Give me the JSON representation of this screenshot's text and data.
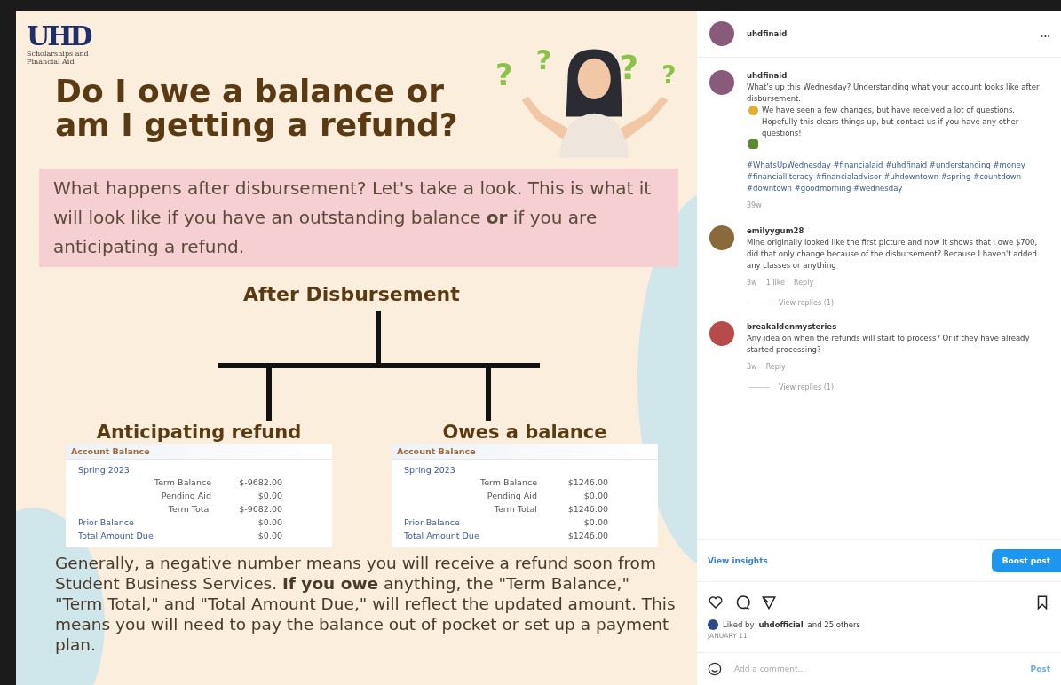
{
  "graphic": {
    "logo": {
      "mark": "UHD",
      "subtitle": "Scholarships and Financial Aid"
    },
    "question_marks": [
      "?",
      "?",
      "?",
      "?"
    ],
    "heading": "Do I owe a balance or am I getting a refund?",
    "intro": "What happens after disbursement? Let's take a look. This is what it will look like if you have an outstanding balance **or** if you are anticipating a refund.",
    "tree_root": "After Disbursement",
    "branches": [
      {
        "label": "Anticipating refund",
        "table": {
          "header": "Account Balance",
          "term": "Spring 2023",
          "rows": [
            {
              "kind": "sub",
              "label": "Term Balance",
              "value": "$-9682.00"
            },
            {
              "kind": "sub",
              "label": "Pending Aid",
              "value": "$0.00"
            },
            {
              "kind": "sub",
              "label": "Term Total",
              "value": "$-9682.00"
            },
            {
              "kind": "main",
              "label": "Prior Balance",
              "value": "$0.00"
            },
            {
              "kind": "main",
              "label": "Total Amount Due",
              "value": "$0.00"
            }
          ]
        }
      },
      {
        "label": "Owes a balance",
        "table": {
          "header": "Account Balance",
          "term": "Spring 2023",
          "rows": [
            {
              "kind": "sub",
              "label": "Term Balance",
              "value": "$1246.00"
            },
            {
              "kind": "sub",
              "label": "Pending Aid",
              "value": "$0.00"
            },
            {
              "kind": "sub",
              "label": "Term Total",
              "value": "$1246.00"
            },
            {
              "kind": "main",
              "label": "Prior Balance",
              "value": "$0.00"
            },
            {
              "kind": "main",
              "label": "Total Amount Due",
              "value": "$1246.00"
            }
          ]
        }
      }
    ],
    "footer": "Generally, a negative number means you will receive a refund soon from Student Business Services. **If you owe** anything, the \"Term Balance,\" \"Term Total,\" and \"Total Amount Due,\" will reflect the updated amount. This means you will need to pay the balance out of pocket or set up a payment plan."
  },
  "sidebar": {
    "author": "uhdfinaid",
    "more": "...",
    "caption": {
      "username": "uhdfinaid",
      "text_1": "What's up this Wednesday? Understanding what your account looks like after disbursement.",
      "text_2": "We have seen a few changes, but have received a lot of questions. Hopefully this clears things up, but contact us if you have any other questions!",
      "hashtags": "#WhatsUpWednesday #financialaid #uhdfinaid #understanding #money #financialliteracy #financialadvisor #uhdowntown #spring #countdown #downtown #goodmorning #wednesday",
      "time": "39w"
    },
    "comments": [
      {
        "username": "emilyygum28",
        "text": "Mine originally looked like the first picture and now it shows that I owe $700, did that only change because of the disbursement? Because I haven't added any classes or anything",
        "meta": [
          "3w",
          "1 like",
          "Reply"
        ],
        "replies": "View replies (1)",
        "color": "#8a6a3a"
      },
      {
        "username": "breakaldenmysteries",
        "text": "Any idea on when the refunds will start to process? Or if they have already started processing?",
        "meta": [
          "3w",
          "Reply"
        ],
        "replies": "View replies (1)",
        "color": "#b84a4a"
      }
    ],
    "insights": "View insights",
    "boost": "Boost post",
    "likes": {
      "prefix": "Liked by",
      "user": "uhdofficial",
      "suffix": "and 25 others"
    },
    "date": "JANUARY 11",
    "comment_placeholder": "Add a comment...",
    "post": "Post"
  }
}
